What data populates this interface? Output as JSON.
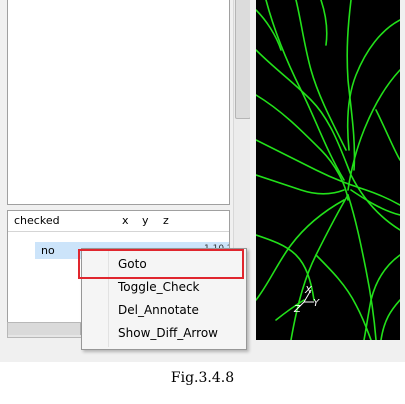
{
  "table": {
    "columns": [
      "checked",
      "x",
      "y",
      "z"
    ],
    "rows": [
      {
        "checked": "no",
        "coord_partial": "1.10.23"
      }
    ]
  },
  "context_menu": {
    "items": [
      "Goto",
      "Toggle_Check",
      "Del_Annotate",
      "Show_Diff_Arrow"
    ],
    "highlighted": "Goto"
  },
  "viewer": {
    "axes": {
      "x": "X",
      "y": "Y",
      "z": "Z"
    },
    "background_color": "#000000",
    "fiber_color": "#22e01a",
    "axis_color": "#ffffff"
  },
  "caption": "Fig.3.4.8",
  "colors": {
    "highlight_border": "#e0262e",
    "selection": "#cce4fa"
  }
}
